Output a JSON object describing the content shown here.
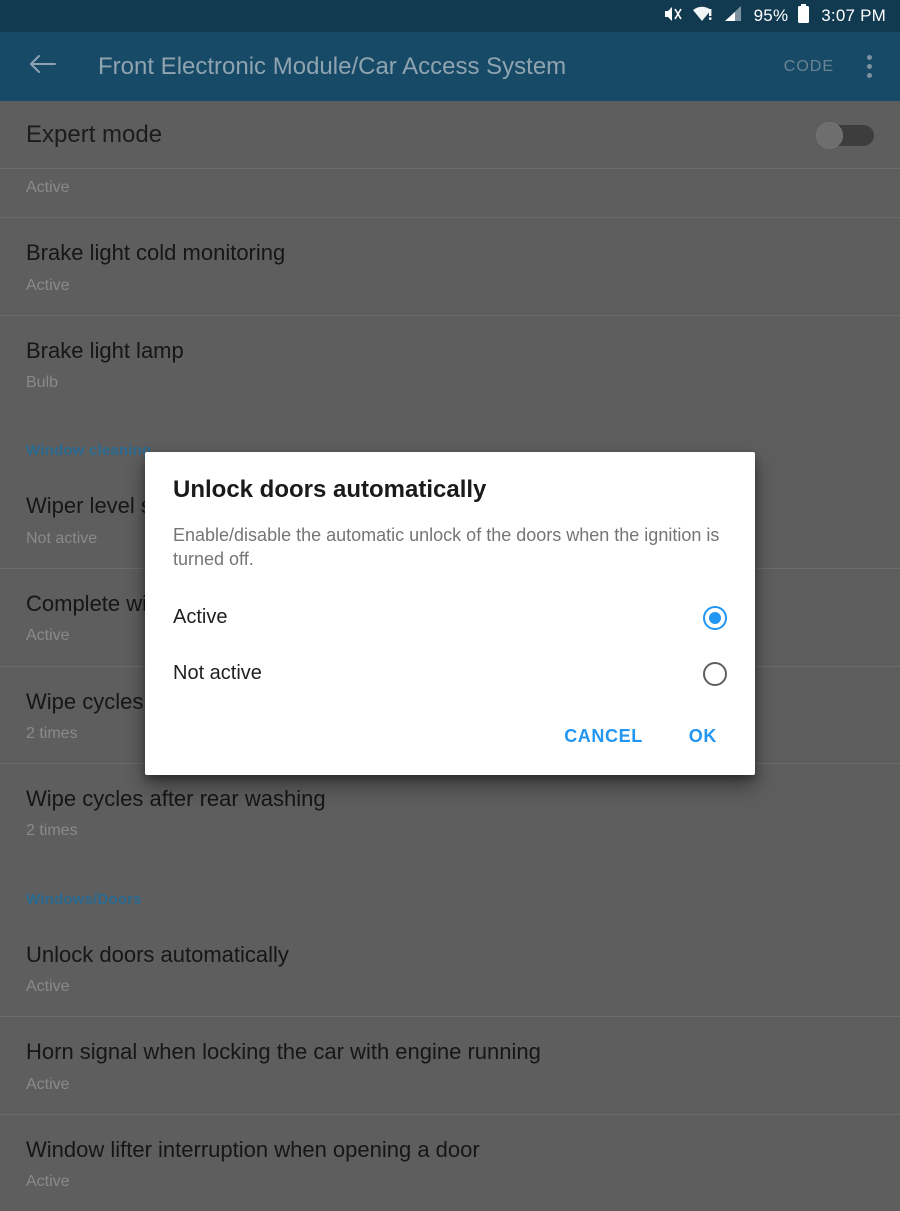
{
  "status_bar": {
    "icons": [
      "mute-icon",
      "wifi-warning-icon",
      "signal-icon"
    ],
    "battery_percent": "95%",
    "time": "3:07 PM"
  },
  "app_bar": {
    "back_icon": "back-arrow-icon",
    "title": "Front Electronic Module/Car Access System",
    "code_label": "CODE",
    "overflow_icon": "overflow-menu-icon"
  },
  "expert_mode": {
    "label": "Expert mode",
    "enabled": false
  },
  "list": [
    {
      "kind": "item",
      "title": "",
      "subtitle": "Active",
      "truncated": true
    },
    {
      "kind": "item",
      "title": "Brake light cold monitoring",
      "subtitle": "Active"
    },
    {
      "kind": "item",
      "title": "Brake light lamp",
      "subtitle": "Bulb"
    },
    {
      "kind": "section",
      "title": "Window cleaning"
    },
    {
      "kind": "item",
      "title": "Wiper level s",
      "subtitle": "Not active"
    },
    {
      "kind": "item",
      "title": "Complete wi",
      "subtitle": "Active"
    },
    {
      "kind": "item",
      "title": "Wipe cycles",
      "subtitle": "2 times"
    },
    {
      "kind": "item",
      "title": "Wipe cycles after rear washing",
      "subtitle": "2 times"
    },
    {
      "kind": "section",
      "title": "Windows/Doors"
    },
    {
      "kind": "item",
      "title": "Unlock doors automatically",
      "subtitle": "Active"
    },
    {
      "kind": "item",
      "title": "Horn signal when locking the car with engine running",
      "subtitle": "Active"
    },
    {
      "kind": "item",
      "title": "Window lifter interruption when opening a door",
      "subtitle": "Active"
    }
  ],
  "dialog": {
    "title": "Unlock doors automatically",
    "message": "Enable/disable the automatic unlock of the doors when the ignition is turned off.",
    "options": [
      {
        "label": "Active",
        "selected": true
      },
      {
        "label": "Not active",
        "selected": false
      }
    ],
    "cancel_label": "CANCEL",
    "ok_label": "OK"
  },
  "colors": {
    "app_bar": "#174a66",
    "status_bar": "#11394f",
    "accent": "#2196f3",
    "section_header": "#2a6a91",
    "scrim_background": "#5e5e5e"
  }
}
